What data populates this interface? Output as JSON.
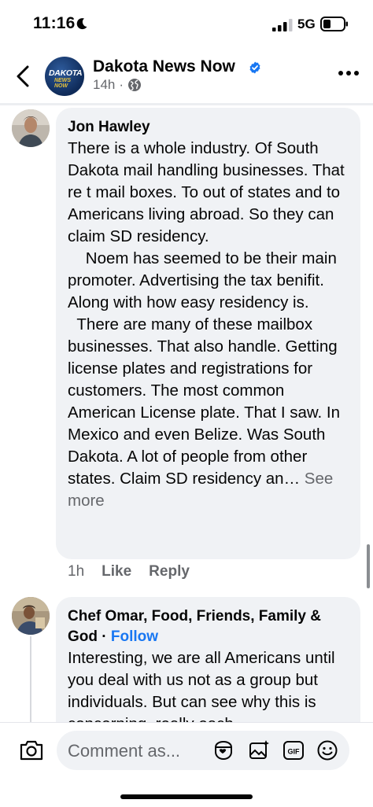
{
  "status_bar": {
    "time": "11:16",
    "network": "5G"
  },
  "header": {
    "page_name": "Dakota News Now",
    "post_age": "14h",
    "separator": "·",
    "avatar_logo_line1": "DAKOTA",
    "avatar_logo_line2": "NEWS NOW"
  },
  "comments": [
    {
      "author": "Jon Hawley",
      "text": "There is a whole industry. Of South Dakota mail handling businesses. That re t mail boxes. To out of states and to Americans living abroad. So they can claim SD residency.\n    Noem has seemed to be their main promoter. Advertising the tax benifit. Along with how easy residency is.\n  There are many of these mailbox businesses. That also handle. Getting license plates and registrations for customers. The most common American License plate. That I saw. In Mexico and even Belize. Was South Dakota. A lot of people from other states. Claim SD residency an… ",
      "see_more": "See more",
      "time": "1h",
      "like": "Like",
      "reply": "Reply"
    },
    {
      "author": "Chef Omar, Food, Friends, Family & God",
      "follow_sep": " · ",
      "follow": "Follow",
      "text": "Interesting, we are all Americans until you deal with us not as a group but individuals. But can see why this is concerning, really each"
    }
  ],
  "composer": {
    "placeholder": "Comment as..."
  },
  "colors": {
    "accent": "#1877f2",
    "bubble": "#f0f2f5",
    "muted": "#65676b"
  }
}
